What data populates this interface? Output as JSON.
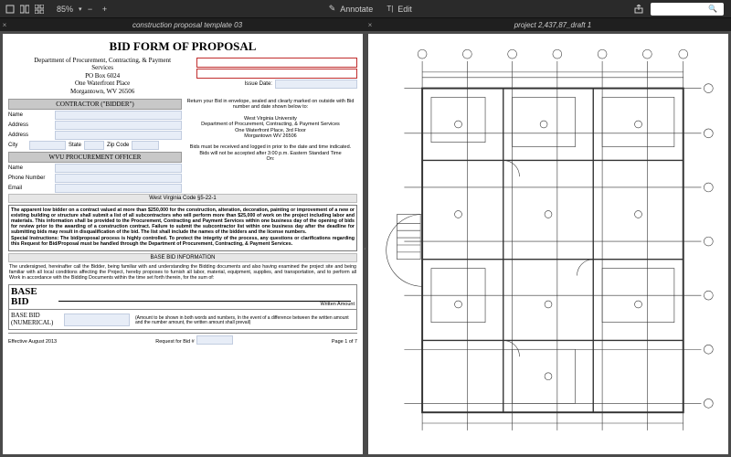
{
  "toolbar": {
    "zoom": "85%",
    "annotate": "Annotate",
    "edit": "Edit"
  },
  "tabs": {
    "left": "construction proposal template 03",
    "right": "project 2,437,87_draft 1"
  },
  "form": {
    "title": "BID FORM OF PROPOSAL",
    "dept_line1": "Department of Procurement, Contracting, & Payment",
    "dept_line2": "Services",
    "po": "PO Box 6024",
    "addr1": "One Waterfront Place",
    "addr2": "Morgantown, WV 26506",
    "issue_date_label": "Issue Date:",
    "contractor_hdr": "CONTRACTOR (\"BIDDER\")",
    "name_label": "Name",
    "address_label": "Address",
    "city_label": "City",
    "state_label": "State",
    "zip_label": "Zip Code",
    "officer_hdr": "WVU PROCUREMENT OFFICER",
    "phone_label": "Phone Number",
    "email_label": "Email",
    "instructions_p1": "Return your Bid in envelope, sealed and clearly marked on outside with Bid number and date shown below to:",
    "instructions_univ": "West Virginia University",
    "instructions_dept": "Department of Procurement, Contracting, & Payment Services",
    "instructions_floor": "One Waterfront Place, 3rd Floor",
    "instructions_city": "Morgantown WV 26506",
    "instructions_p2": "Bids must be received and logged in prior to the date and time indicated.  Bids will not be accepted after 3:00 p.m. Eastern Standard Time",
    "instructions_on": "On:",
    "code_hdr": "West Virginia Code §5-22-1",
    "legal1": "The apparent low bidder on a contract valued at more than $250,000 for the construction, alteration, decoration, painting or improvement of a new or existing building or structure shall submit a list of all subcontractors who will perform more than $25,000 of work on the project including labor and materials. This information shall be provided to the Procurement, Contracting and Payment Services within one business day of the opening of bids for review prior to the awarding of a construction contract. Failure to submit the subcontractor list within one business day after the deadline for submitting bids may result in disqualification of the bid. The list shall include the names of the bidders and the license numbers.",
    "legal2": "Special Instructions:  The bid/proposal process is highly controlled.   To protect the integrity of the process, any questions or clarifications regarding this Request for Bid/Proposal must be handled through the Department of Procurement, Contracting, & Payment Services.",
    "bbinfo_hdr": "BASE BID INFORMATION",
    "bb_text": "The undersigned, hereinafter call the Bidder, being familiar  with and understanding the Bidding documents and also having examined the project site and being familiar with all local conditions affecting the Project, hereby proposes to furnish all labor, material, equipment, supplies, and transportation, and to perform all Work in accordance with the Bidding Documents within the time set forth therein, for the sum of:",
    "base_bid_1": "BASE",
    "base_bid_2": "BID",
    "written_amount": "Written Amount",
    "bb_num_label": "BASE BID (NUMERICAL)",
    "bb_num_note": "(Amount to be shown in both words and numbers, In the event of a difference between the written amount and the number amount, the written amount shall prevail)",
    "effective": "Effective August 2013",
    "request_label": "Request for Bid #",
    "page": "Page 1 of 7"
  }
}
